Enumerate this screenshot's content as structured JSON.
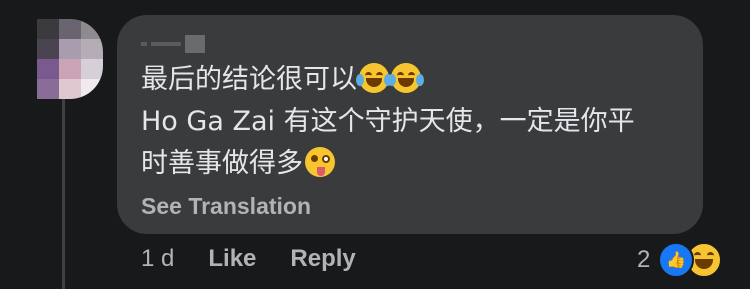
{
  "comment": {
    "lines": [
      "最后的结论很可以",
      "Ho Ga Zai 有这个守护天使，一定是你平",
      "时善事做得多"
    ],
    "see_translation": "See Translation"
  },
  "actions": {
    "time": "1 d",
    "like": "Like",
    "reply": "Reply"
  },
  "reactions": {
    "count": "2",
    "icons": [
      "like-reaction-icon",
      "haha-reaction-icon"
    ]
  },
  "colors": {
    "background": "#18191a",
    "bubble": "#3a3b3c",
    "text": "#e4e6eb",
    "secondary_text": "#b0b3b8",
    "like_blue": "#1877f2"
  }
}
